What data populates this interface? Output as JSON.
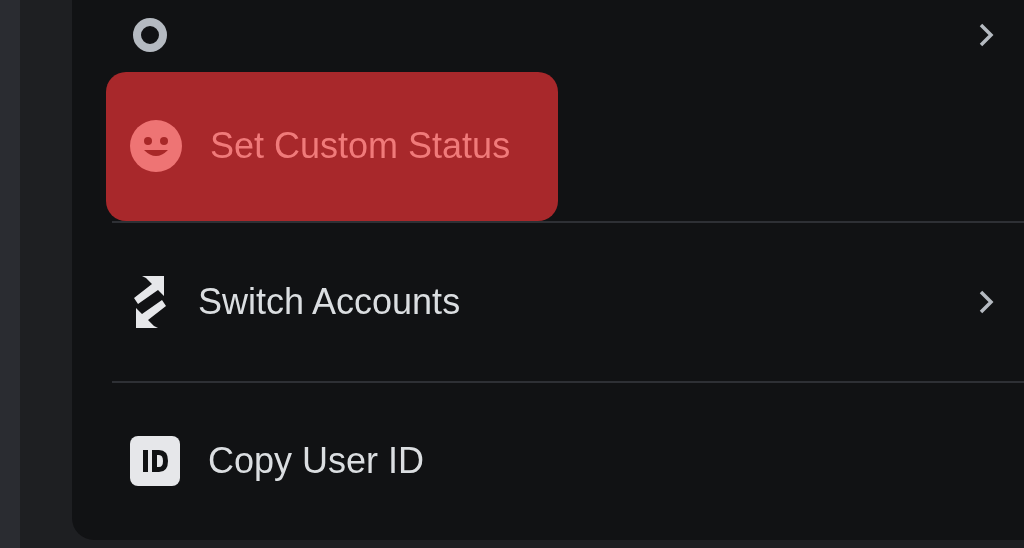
{
  "menu": {
    "items": [
      {
        "kind": "status",
        "submenu": true,
        "selected": false,
        "divider_before": false
      },
      {
        "kind": "emoji",
        "label": "Set Custom Status",
        "submenu": false,
        "selected": true,
        "divider_before": false
      },
      {
        "kind": "switch",
        "label": "Switch Accounts",
        "submenu": true,
        "selected": false,
        "divider_before": true
      },
      {
        "kind": "id",
        "label": "Copy User ID",
        "submenu": false,
        "selected": false,
        "divider_before": true
      }
    ]
  }
}
